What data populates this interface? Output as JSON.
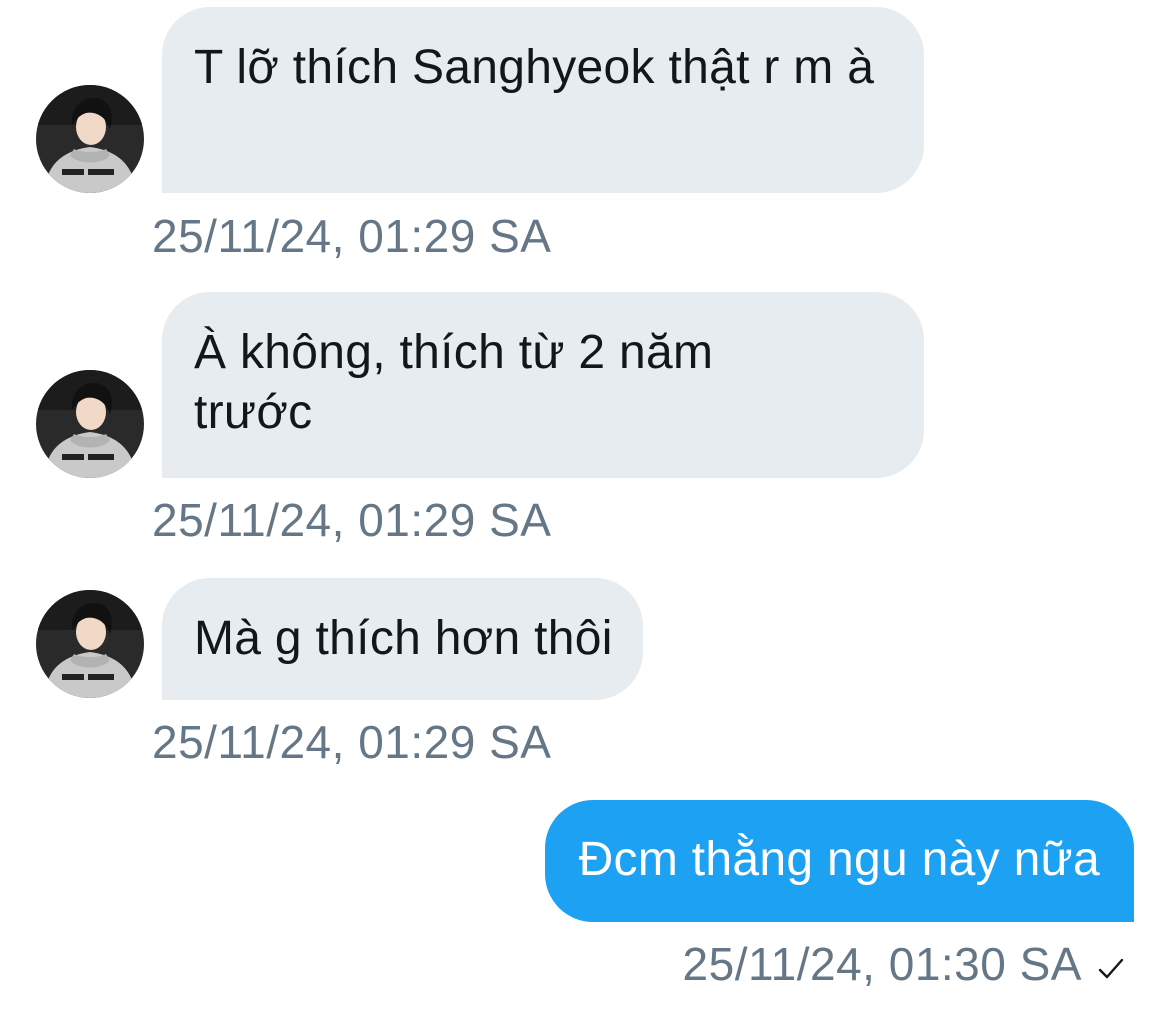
{
  "conversation": {
    "messages": [
      {
        "direction": "incoming",
        "text": "T lỡ thích Sanghyeok thật r m à",
        "timestamp": "25/11/24, 01:29 SA",
        "avatar": "user-avatar-photo"
      },
      {
        "direction": "incoming",
        "text": "À không, thích từ 2 năm trước",
        "timestamp": "25/11/24, 01:29 SA",
        "avatar": "user-avatar-photo"
      },
      {
        "direction": "incoming",
        "text": "Mà g thích hơn thôi",
        "timestamp": "25/11/24, 01:29 SA",
        "avatar": "user-avatar-photo"
      },
      {
        "direction": "outgoing",
        "text": "Đcm thằng ngu này nữa",
        "timestamp": "25/11/24, 01:30 SA",
        "status_icon": "checkmark-icon"
      }
    ]
  },
  "colors": {
    "incoming_bubble": "#e6ecf0",
    "outgoing_bubble": "#1da1f2",
    "timestamp": "#657786",
    "text_dark": "#14171a"
  }
}
